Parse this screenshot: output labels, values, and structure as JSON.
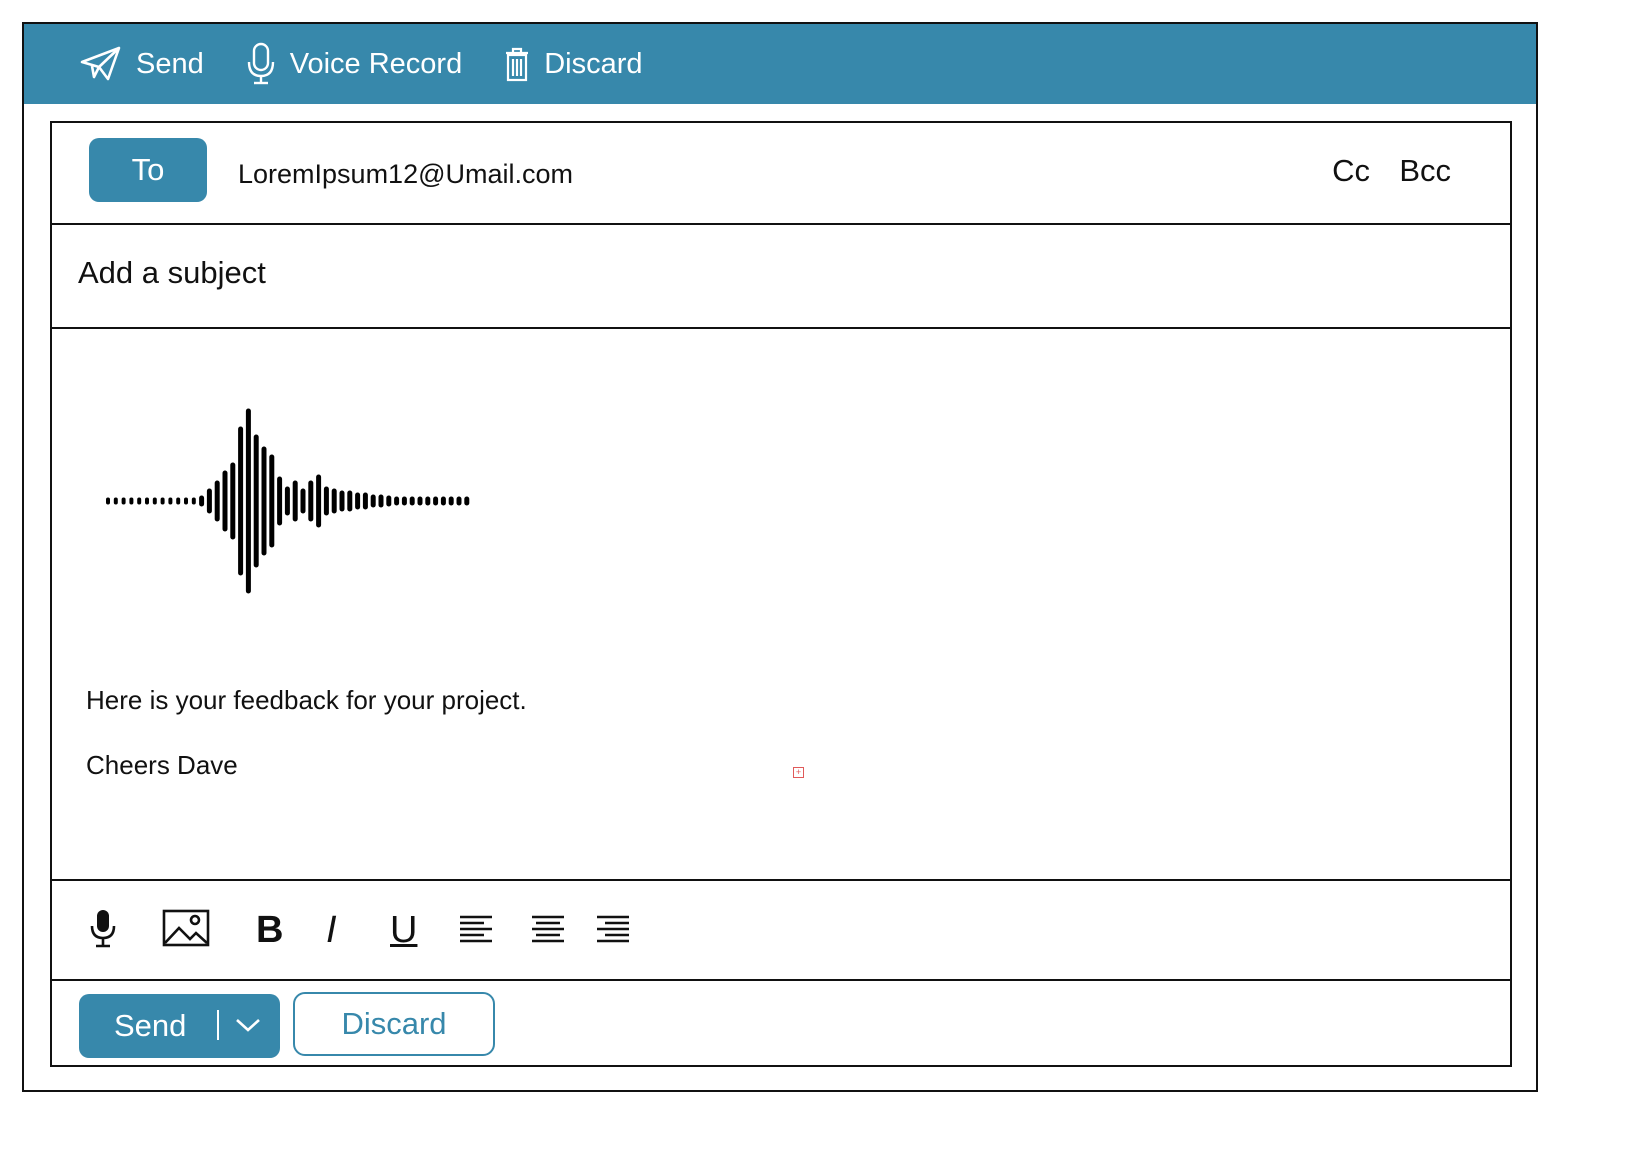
{
  "colors": {
    "accent": "#3788ab",
    "border": "#111111"
  },
  "topbar": {
    "send": {
      "label": "Send",
      "icon": "paper-plane-icon"
    },
    "voice_record": {
      "label": "Voice Record",
      "icon": "microphone-icon"
    },
    "discard": {
      "label": "Discard",
      "icon": "trash-icon"
    }
  },
  "compose": {
    "to_label": "To",
    "to_value": "LoremIpsum12@Umail.com",
    "cc_label": "Cc",
    "bcc_label": "Bcc",
    "subject_placeholder": "Add a subject",
    "attachment": {
      "type": "voice-recording",
      "icon": "waveform-icon"
    },
    "body_lines": [
      "Here is your feedback for your project.",
      "Cheers Dave"
    ]
  },
  "format_toolbar": {
    "items": [
      {
        "name": "microphone",
        "icon": "microphone-icon"
      },
      {
        "name": "insert-image",
        "icon": "image-icon"
      },
      {
        "name": "bold",
        "glyph": "B"
      },
      {
        "name": "italic",
        "glyph": "I"
      },
      {
        "name": "underline",
        "glyph": "U"
      },
      {
        "name": "align-left",
        "icon": "align-left-icon"
      },
      {
        "name": "align-center",
        "icon": "align-center-icon"
      },
      {
        "name": "align-right",
        "icon": "align-right-icon"
      }
    ]
  },
  "actions": {
    "send_label": "Send",
    "discard_label": "Discard"
  }
}
